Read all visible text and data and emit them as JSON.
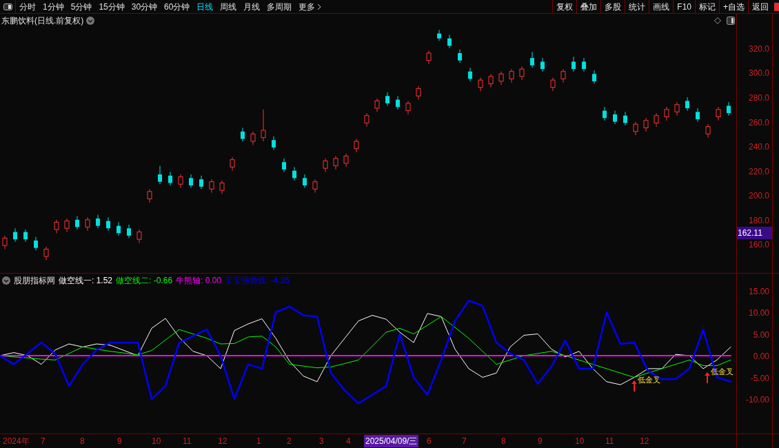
{
  "toolbar": {
    "tabs": [
      {
        "label": "分时",
        "selected": false
      },
      {
        "label": "1分钟",
        "selected": false
      },
      {
        "label": "5分钟",
        "selected": false
      },
      {
        "label": "15分钟",
        "selected": false
      },
      {
        "label": "30分钟",
        "selected": false
      },
      {
        "label": "60分钟",
        "selected": false
      },
      {
        "label": "日线",
        "selected": true
      },
      {
        "label": "周线",
        "selected": false
      },
      {
        "label": "月线",
        "selected": false
      },
      {
        "label": "多周期",
        "selected": false
      }
    ],
    "more": "更多",
    "buttons": [
      "复权",
      "叠加",
      "多股",
      "统计",
      "画线",
      "F10",
      "标记",
      "+自选",
      "返回"
    ]
  },
  "main_chart": {
    "title": "东鹏饮料(日线.前复权)",
    "price_tag": "162.11",
    "chart_data": {
      "type": "candlestick",
      "ylim": [
        136,
        348.1
      ],
      "yticks": [
        {
          "value": 320,
          "label": "320.0"
        },
        {
          "value": 300,
          "label": "300.0"
        },
        {
          "value": 280,
          "label": "280.0"
        },
        {
          "value": 260,
          "label": "260.0"
        },
        {
          "value": 240,
          "label": "240.0"
        },
        {
          "value": 220,
          "label": "220.0"
        },
        {
          "value": 200,
          "label": "200.0"
        },
        {
          "value": 180,
          "label": "180.0"
        },
        {
          "value": 160,
          "label": "160.0"
        }
      ],
      "ohlc": [
        [
          159,
          167,
          156,
          165
        ],
        [
          170,
          173,
          162,
          164
        ],
        [
          170,
          172,
          162,
          164
        ],
        [
          163,
          166,
          155,
          157
        ],
        [
          150,
          158,
          147,
          156
        ],
        [
          172,
          180,
          169,
          178
        ],
        [
          173,
          181,
          170,
          179
        ],
        [
          180,
          183,
          172,
          174
        ],
        [
          174,
          182,
          171,
          180
        ],
        [
          181,
          184,
          173,
          175
        ],
        [
          179,
          182,
          171,
          173
        ],
        [
          175,
          178,
          167,
          169
        ],
        [
          173,
          176,
          165,
          167
        ],
        [
          164,
          172,
          161,
          170
        ],
        [
          197,
          205,
          194,
          203
        ],
        [
          217,
          224,
          209,
          211
        ],
        [
          216,
          219,
          208,
          210
        ],
        [
          209,
          217,
          206,
          215
        ],
        [
          214,
          217,
          206,
          208
        ],
        [
          213,
          216,
          205,
          207
        ],
        [
          205,
          213,
          202,
          211
        ],
        [
          204,
          212,
          201,
          210
        ],
        [
          223,
          231,
          220,
          229
        ],
        [
          252,
          255,
          244,
          246
        ],
        [
          244,
          252,
          241,
          250
        ],
        [
          247,
          270,
          244,
          253
        ],
        [
          245,
          248,
          237,
          239
        ],
        [
          227,
          230,
          219,
          221
        ],
        [
          220,
          223,
          212,
          214
        ],
        [
          214,
          217,
          206,
          208
        ],
        [
          205,
          213,
          202,
          211
        ],
        [
          222,
          230,
          219,
          228
        ],
        [
          224,
          232,
          221,
          230
        ],
        [
          226,
          234,
          223,
          232
        ],
        [
          238,
          246,
          235,
          244
        ],
        [
          259,
          267,
          256,
          265
        ],
        [
          271,
          279,
          268,
          277
        ],
        [
          281,
          284,
          273,
          275
        ],
        [
          278,
          281,
          270,
          272
        ],
        [
          269,
          277,
          266,
          275
        ],
        [
          281,
          289,
          278,
          287
        ],
        [
          310,
          318,
          307,
          316
        ],
        [
          332,
          335,
          326,
          328
        ],
        [
          328,
          331,
          320,
          322
        ],
        [
          316,
          319,
          308,
          310
        ],
        [
          301,
          304,
          293,
          295
        ],
        [
          288,
          296,
          285,
          294
        ],
        [
          291,
          299,
          288,
          297
        ],
        [
          293,
          301,
          290,
          299
        ],
        [
          295,
          303,
          292,
          301
        ],
        [
          297,
          305,
          294,
          303
        ],
        [
          312,
          317,
          304,
          306
        ],
        [
          309,
          312,
          301,
          303
        ],
        [
          288,
          296,
          285,
          294
        ],
        [
          295,
          303,
          292,
          301
        ],
        [
          309,
          313,
          301,
          303
        ],
        [
          309,
          312,
          301,
          303
        ],
        [
          299,
          302,
          291,
          293
        ],
        [
          269,
          272,
          261,
          263
        ],
        [
          266,
          269,
          258,
          260
        ],
        [
          265,
          268,
          257,
          259
        ],
        [
          252,
          260,
          249,
          258
        ],
        [
          255,
          263,
          252,
          261
        ],
        [
          259,
          267,
          256,
          265
        ],
        [
          264,
          272,
          261,
          270
        ],
        [
          268,
          276,
          265,
          274
        ],
        [
          277,
          280,
          269,
          271
        ],
        [
          268,
          271,
          260,
          262
        ],
        [
          250,
          258,
          247,
          256
        ],
        [
          264,
          272,
          261,
          270
        ],
        [
          273,
          276,
          265,
          267
        ]
      ]
    }
  },
  "indicator": {
    "name": "股朋指标网",
    "legend_values": [
      ": 1.52",
      ": -0.66",
      ": 0.00",
      ": -4.35"
    ],
    "signals": [
      "低金叉",
      "低金叉"
    ],
    "chart_data": {
      "type": "line",
      "ylim": [
        -18.1,
        18.9
      ],
      "yticks": [
        {
          "value": 15,
          "label": "15.00"
        },
        {
          "value": 10,
          "label": "10.00"
        },
        {
          "value": 5,
          "label": "5.00"
        },
        {
          "value": 0,
          "label": "0.00"
        },
        {
          "value": -5,
          "label": "-5.00"
        },
        {
          "value": -10,
          "label": "-10.00"
        }
      ],
      "series": [
        {
          "name": "做空线一",
          "color": "#ffffff",
          "values": [
            0,
            0.7,
            0,
            -2,
            1.3,
            2.7,
            2,
            2.7,
            2.4,
            1.2,
            0,
            6.3,
            8.6,
            4.2,
            1,
            0,
            -3,
            5.8,
            7.3,
            8.5,
            4,
            -1.3,
            -4.7,
            -6,
            0,
            4,
            8,
            9.3,
            8.4,
            5.4,
            3,
            9.7,
            9,
            1.5,
            -3,
            -5,
            -4,
            2,
            4.7,
            5,
            1.5,
            -0.3,
            1,
            -3,
            -6,
            -6.7,
            -5,
            -3,
            -3,
            0.3,
            0,
            -3,
            -1,
            2
          ]
        },
        {
          "name": "做空线二",
          "color": "#00ff00",
          "values": [
            0,
            -0.3,
            -0.5,
            -0.8,
            -1,
            0.5,
            2,
            1.5,
            1,
            0.6,
            0.2,
            1.2,
            3.6,
            6,
            5,
            4,
            2.7,
            2.8,
            4.3,
            4.5,
            2,
            -2,
            -2.4,
            -2.8,
            -2.6,
            -1.8,
            -1,
            2.2,
            5.4,
            6.3,
            5,
            7,
            9,
            6.5,
            4,
            1,
            -2,
            -1,
            0,
            0.5,
            1,
            0,
            -1,
            -2,
            -3,
            -4,
            -5,
            -4,
            -3,
            -2,
            -1,
            -2.3,
            -2.3,
            -1
          ]
        },
        {
          "name": "牛熊轴",
          "color": "#ff00ff",
          "values": [
            0,
            0,
            0,
            0,
            0,
            0,
            0,
            0,
            0,
            0,
            0,
            0,
            0,
            0,
            0,
            0,
            0,
            0,
            0,
            0,
            0,
            0,
            0,
            0,
            0,
            0,
            0,
            0,
            0,
            0,
            0,
            0,
            0,
            0,
            0,
            0,
            0,
            0,
            0,
            0,
            0,
            0,
            0,
            0,
            0,
            0,
            0,
            0,
            0,
            0,
            0,
            0,
            0,
            0
          ]
        },
        {
          "name": "宝宝强势线",
          "color": "#0000ff",
          "values": [
            0,
            -2,
            0.5,
            3,
            0.5,
            -7,
            -2,
            1.3,
            3,
            3,
            3,
            -10,
            -7,
            3,
            4.5,
            6,
            0,
            -10,
            -2,
            -3,
            10,
            11.3,
            9.3,
            9,
            -4,
            -8,
            -11,
            -9,
            -7,
            5,
            -5,
            -9,
            -1,
            8,
            12.7,
            11.5,
            3,
            0.5,
            -1,
            -6.5,
            -2.5,
            3.5,
            -3,
            -3,
            10,
            2.7,
            3,
            -3.5,
            -5.4,
            -5.4,
            -3,
            6,
            -5,
            -6
          ]
        }
      ]
    }
  },
  "time_axis": [
    {
      "label": "2024年",
      "highlighted": false
    },
    {
      "label": "7",
      "highlighted": false
    },
    {
      "label": "8",
      "highlighted": false
    },
    {
      "label": "9",
      "highlighted": false
    },
    {
      "label": "10",
      "highlighted": false
    },
    {
      "label": "11",
      "highlighted": false
    },
    {
      "label": "12",
      "highlighted": false
    },
    {
      "label": "1",
      "highlighted": false
    },
    {
      "label": "2",
      "highlighted": false
    },
    {
      "label": "3",
      "highlighted": false
    },
    {
      "label": "4",
      "highlighted": false
    },
    {
      "label": "2025/04/09/三",
      "highlighted": true
    },
    {
      "label": "6",
      "highlighted": false
    },
    {
      "label": "7",
      "highlighted": false
    },
    {
      "label": "8",
      "highlighted": false
    },
    {
      "label": "9",
      "highlighted": false
    },
    {
      "label": "10",
      "highlighted": false
    },
    {
      "label": "11",
      "highlighted": false
    },
    {
      "label": "12",
      "highlighted": false
    }
  ]
}
